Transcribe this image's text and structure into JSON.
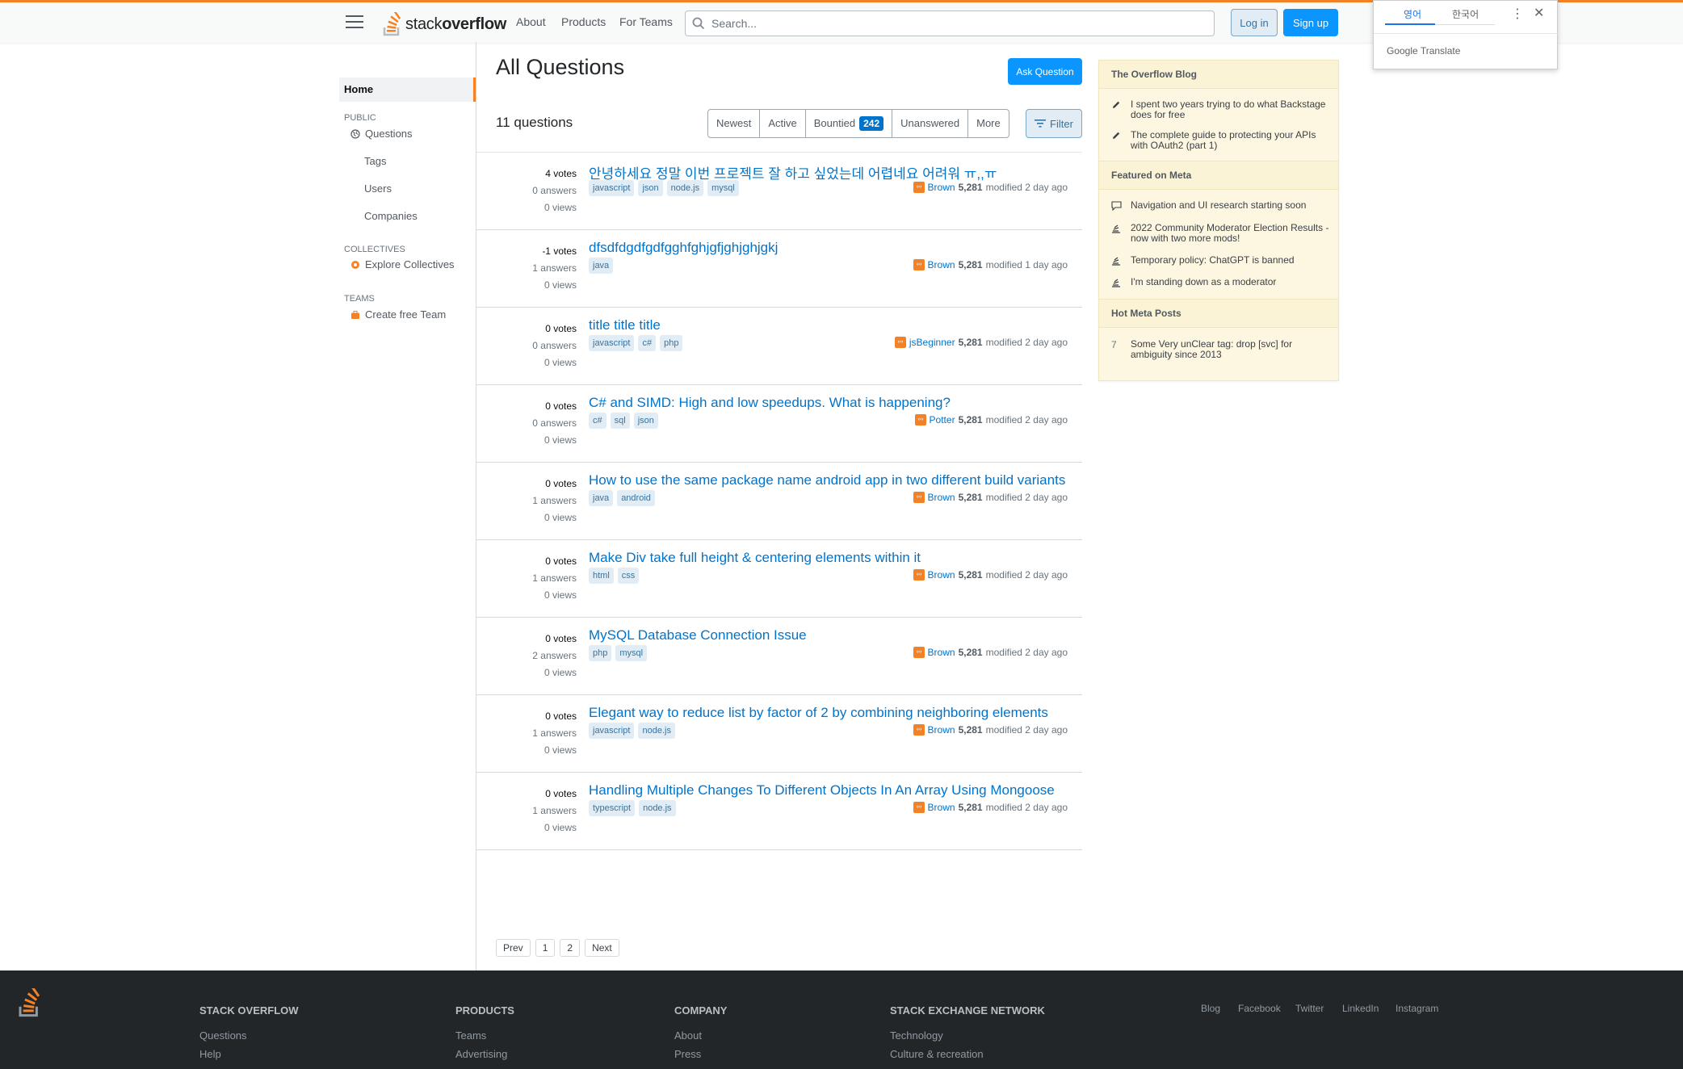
{
  "header": {
    "logo_text_a": "stack",
    "logo_text_b": "overflow",
    "nav": [
      "About",
      "Products",
      "For Teams"
    ],
    "search_placeholder": "Search...",
    "login": "Log in",
    "signup": "Sign up"
  },
  "translate": {
    "tab_active": "영어",
    "tab_other": "한국어",
    "brand_google": "Google",
    "brand_translate": "Translate"
  },
  "sidebar": {
    "home": "Home",
    "public": "PUBLIC",
    "questions": "Questions",
    "tags": "Tags",
    "users": "Users",
    "companies": "Companies",
    "collectives": "COLLECTIVES",
    "explore": "Explore Collectives",
    "teams": "TEAMS",
    "create_team": "Create free Team"
  },
  "main": {
    "title": "All Questions",
    "ask": "Ask Question",
    "count": "11 questions",
    "filters": [
      "Newest",
      "Active",
      "Bountied",
      "Unanswered",
      "More"
    ],
    "bounty_badge": "242",
    "filter_btn": "Filter"
  },
  "questions": [
    {
      "votes": "4 votes",
      "answers": "0 answers",
      "views": "0 views",
      "title": "안녕하세요 정말 이번 프로젝트 잘 하고 싶었는데 어렵네요 어려워 ㅠ,,ㅠ",
      "tags": [
        "javascript",
        "json",
        "node.js",
        "mysql"
      ],
      "user": "Brown",
      "rep": "5,281",
      "time": "modified 2 day ago"
    },
    {
      "votes": "-1 votes",
      "answers": "1 answers",
      "views": "0 views",
      "title": "dfsdfdgdfgdfgghfghjgfjghjghjgkj",
      "tags": [
        "java"
      ],
      "user": "Brown",
      "rep": "5,281",
      "time": "modified 1 day ago"
    },
    {
      "votes": "0 votes",
      "answers": "0 answers",
      "views": "0 views",
      "title": "title title title",
      "tags": [
        "javascript",
        "c#",
        "php"
      ],
      "user": "jsBeginner",
      "rep": "5,281",
      "time": "modified 2 day ago"
    },
    {
      "votes": "0 votes",
      "answers": "0 answers",
      "views": "0 views",
      "title": "C# and SIMD: High and low speedups. What is happening?",
      "tags": [
        "c#",
        "sql",
        "json"
      ],
      "user": "Potter",
      "rep": "5,281",
      "time": "modified 2 day ago"
    },
    {
      "votes": "0 votes",
      "answers": "1 answers",
      "views": "0 views",
      "title": "How to use the same package name android app in two different build variants",
      "tags": [
        "java",
        "android"
      ],
      "user": "Brown",
      "rep": "5,281",
      "time": "modified 2 day ago"
    },
    {
      "votes": "0 votes",
      "answers": "1 answers",
      "views": "0 views",
      "title": "Make Div take full height & centering elements within it",
      "tags": [
        "html",
        "css"
      ],
      "user": "Brown",
      "rep": "5,281",
      "time": "modified 2 day ago"
    },
    {
      "votes": "0 votes",
      "answers": "2 answers",
      "views": "0 views",
      "title": "MySQL Database Connection Issue",
      "tags": [
        "php",
        "mysql"
      ],
      "user": "Brown",
      "rep": "5,281",
      "time": "modified 2 day ago"
    },
    {
      "votes": "0 votes",
      "answers": "1 answers",
      "views": "0 views",
      "title": "Elegant way to reduce list by factor of 2 by combining neighboring elements",
      "tags": [
        "javascript",
        "node.js"
      ],
      "user": "Brown",
      "rep": "5,281",
      "time": "modified 2 day ago"
    },
    {
      "votes": "0 votes",
      "answers": "1 answers",
      "views": "0 views",
      "title": "Handling Multiple Changes To Different Objects In An Array Using Mongoose",
      "tags": [
        "typescript",
        "node.js"
      ],
      "user": "Brown",
      "rep": "5,281",
      "time": "modified 2 day ago"
    }
  ],
  "pager": {
    "prev": "Prev",
    "p1": "1",
    "p2": "2",
    "next": "Next"
  },
  "rightbar": {
    "blog_head": "The Overflow Blog",
    "blog1": "I spent two years trying to do what Backstage does for free",
    "blog2": "The complete guide to protecting your APIs with OAuth2 (part 1)",
    "meta_head": "Featured on Meta",
    "meta1": "Navigation and UI research starting soon",
    "meta2": "2022 Community Moderator Election Results - now with two more mods!",
    "meta3": "Temporary policy: ChatGPT is banned",
    "meta4": "I'm standing down as a moderator",
    "hot_head": "Hot Meta Posts",
    "hot1_count": "7",
    "hot1": "Some Very unClear tag: drop [svc] for ambiguity since 2013"
  },
  "footer": {
    "col1_h": "STACK OVERFLOW",
    "col1": [
      "Questions",
      "Help"
    ],
    "col2_h": "PRODUCTS",
    "col2": [
      "Teams",
      "Advertising"
    ],
    "col3_h": "COMPANY",
    "col3": [
      "About",
      "Press"
    ],
    "col4_h": "STACK EXCHANGE NETWORK",
    "col4": [
      "Technology",
      "Culture & recreation"
    ],
    "social": [
      "Blog",
      "Facebook",
      "Twitter",
      "LinkedIn",
      "Instagram"
    ]
  },
  "colors": {
    "accent": "#f48225",
    "primary": "#0a95ff",
    "link": "#0074cc",
    "tag_bg": "#e1ecf4"
  }
}
